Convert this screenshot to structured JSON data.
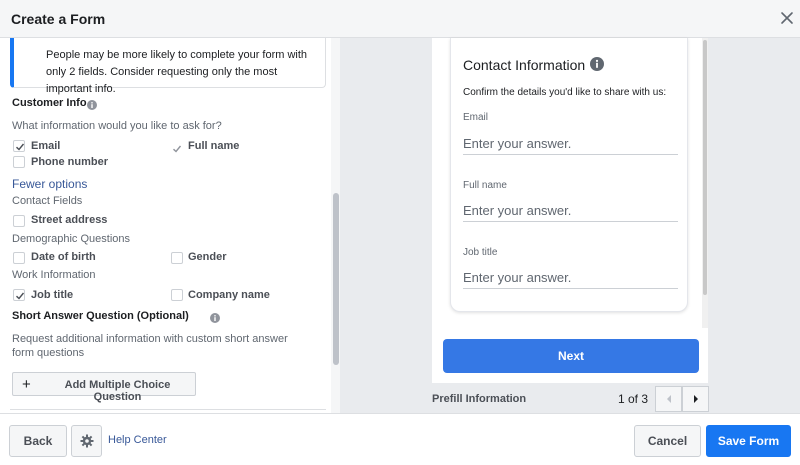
{
  "header": {
    "title": "Create a Form"
  },
  "notice": {
    "text": "People may be more likely to complete your form with only 2 fields. Consider requesting only the most important info."
  },
  "customer_info": {
    "title": "Customer Info",
    "prompt": "What information would you like to ask for?",
    "fields": [
      {
        "label": "Email",
        "checked": true
      },
      {
        "label": "Full name",
        "checked": true
      },
      {
        "label": "Phone number",
        "checked": false
      }
    ],
    "fewer_options_label": "Fewer options",
    "contact_fields": {
      "heading": "Contact Fields",
      "items": [
        {
          "label": "Street address",
          "checked": false
        }
      ]
    },
    "demographic": {
      "heading": "Demographic Questions",
      "items": [
        {
          "label": "Date of birth",
          "checked": false
        },
        {
          "label": "Gender",
          "checked": false
        }
      ]
    },
    "work": {
      "heading": "Work Information",
      "items": [
        {
          "label": "Job title",
          "checked": true
        },
        {
          "label": "Company name",
          "checked": false
        }
      ]
    }
  },
  "short_answer": {
    "title": "Short Answer Question (Optional)",
    "description": "Request additional information with custom short answer form questions",
    "add_button_label": "Add Multiple Choice Question"
  },
  "preview": {
    "card_title": "Contact Information",
    "card_subtitle": "Confirm the details you'd like to share with us:",
    "fields": [
      {
        "label": "Email",
        "placeholder": "Enter your answer."
      },
      {
        "label": "Full name",
        "placeholder": "Enter your answer."
      },
      {
        "label": "Job title",
        "placeholder": "Enter your answer."
      }
    ],
    "next_label": "Next",
    "prefill_label": "Prefill Information",
    "pager_text": "1 of 3"
  },
  "footer": {
    "back_label": "Back",
    "help_label": "Help Center",
    "cancel_label": "Cancel",
    "save_label": "Save Form"
  },
  "colors": {
    "accent": "#1877f2",
    "next_button": "#3578e5",
    "link": "#385898"
  }
}
